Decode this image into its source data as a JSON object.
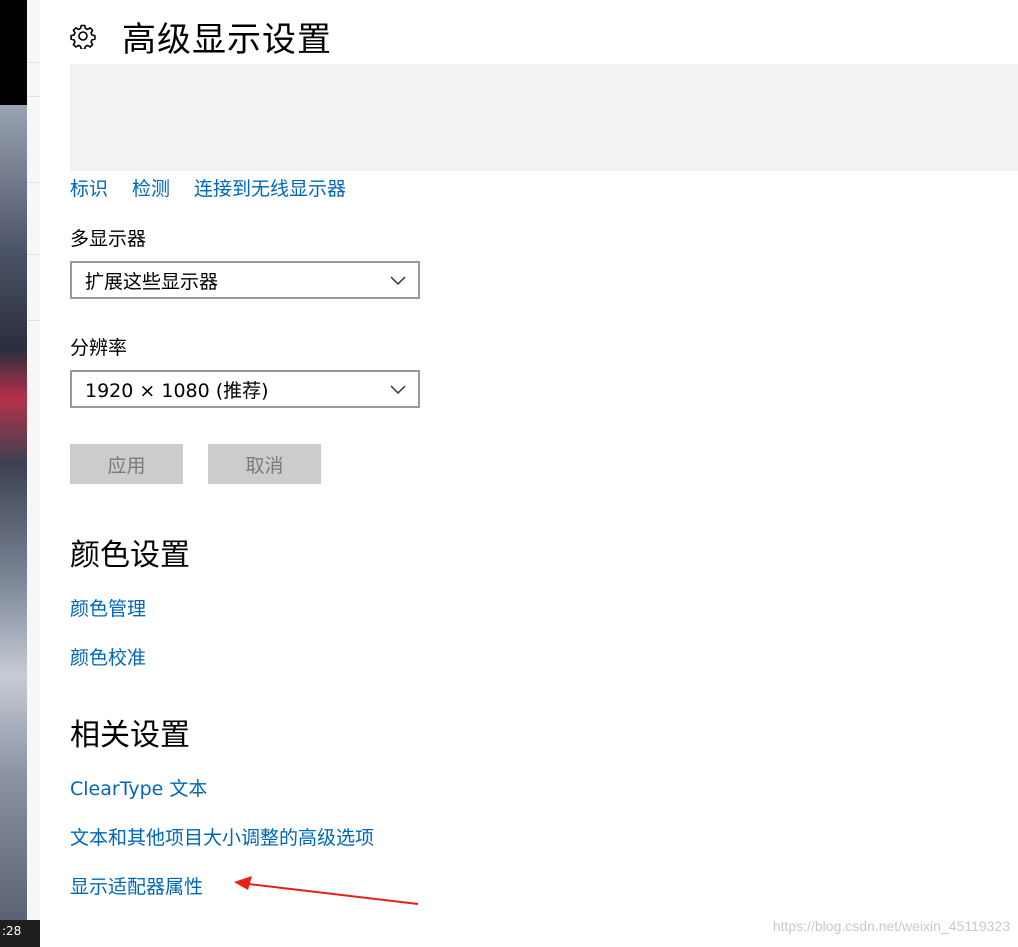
{
  "window": {
    "title": "高级显示设置",
    "icon": "gear-icon"
  },
  "display_links": [
    "标识",
    "检测",
    "连接到无线显示器"
  ],
  "multi_display": {
    "label": "多显示器",
    "value": "扩展这些显示器"
  },
  "resolution": {
    "label": "分辨率",
    "value": "1920 × 1080 (推荐)"
  },
  "buttons": {
    "apply": "应用",
    "cancel": "取消"
  },
  "color_settings": {
    "title": "颜色设置",
    "links": [
      "颜色管理",
      "颜色校准"
    ]
  },
  "related_settings": {
    "title": "相关设置",
    "links": [
      "ClearType 文本",
      "文本和其他项目大小调整的高级选项",
      "显示适配器属性"
    ]
  },
  "taskbar": {
    "clock": ":28"
  },
  "watermark": "https://blog.csdn.net/weixin_45119323",
  "colors": {
    "link": "#0067b8",
    "arrow": "#e8201a",
    "button_disabled_bg": "#cccccc",
    "preview_bg": "#f2f2f2"
  }
}
